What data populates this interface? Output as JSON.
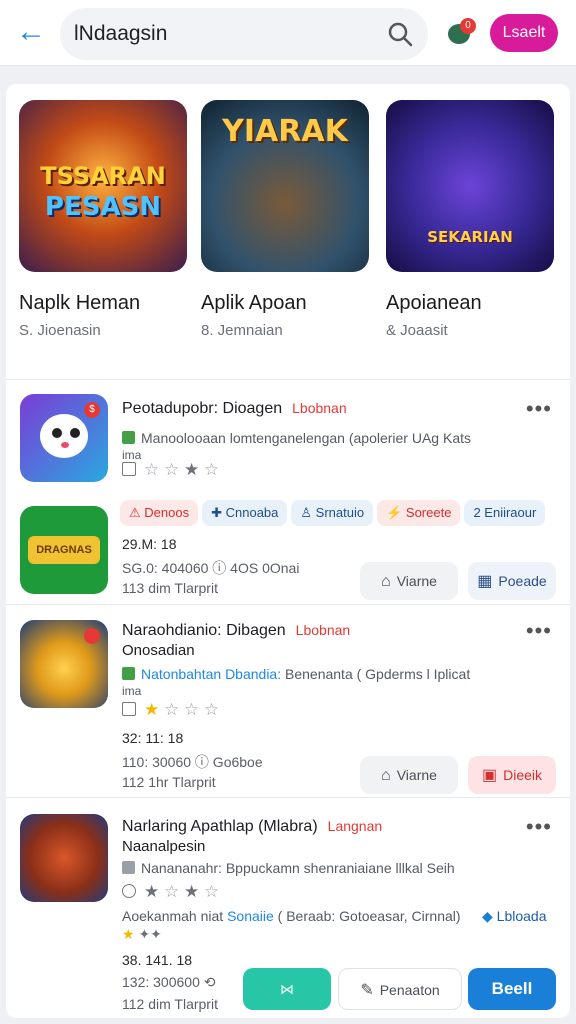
{
  "header": {
    "search_text": "lNdaagsin",
    "notification_count": "0",
    "action_label": "Lsaelt"
  },
  "featured": [
    {
      "art_line1": "TSSARAN",
      "art_line2": "PESASN",
      "name": "Naplk Heman",
      "sub": "S. Jioenasin"
    },
    {
      "art_line1": "YIARAK",
      "name": "Aplik Apoan",
      "sub": "8. Jemnaian"
    },
    {
      "art_line1": "SEKARIAN",
      "name": "Apoianean",
      "sub": "& Joaasit"
    }
  ],
  "items": [
    {
      "title": "Peotadupobr: Dioagen",
      "tag": "Lbobnan",
      "desc": "Manoolooaan lomtenganelengan (apolerier UAg Kats",
      "desc_extra": "ima",
      "chips": [
        "Denoos",
        "Cnnoaba",
        "Srnatuio",
        "Soreete",
        "Eniiraour"
      ],
      "stat1": "29.M: 18",
      "stat2": "SG.0:  404060   ⓘ  4OS 0Onai",
      "stat3": "113 dim  Tlarprit",
      "btn1": "Viarne",
      "btn2": "Poeade"
    },
    {
      "title": "Naraohdianio: Dibagen",
      "tag": "Lbobnan",
      "title2": "Onosadian",
      "desc_hl": "Natonbahtan Dbandia:",
      "desc": " Benenanta ( Gpderms l Iplicat",
      "desc_extra": "ima",
      "stat1": "32: 11: 18",
      "stat2": "110: 30060   ⓘ  Go6boe",
      "stat3": "112 1hr  Tlarprit",
      "btn1": "Viarne",
      "btn2": "Dieeik"
    },
    {
      "title": "Narlaring Apathlap (Mlabra)",
      "tag": "Langnan",
      "title2": "Naanalpesin",
      "desc": "Nanananahr: Bppuckamn shenraniaiane  lllkal Seih",
      "line4_pre": "Aoekanmah niat ",
      "line4_hl": "Sonaiie",
      "line4_post": " ( Beraab: Gotoeasar, Cirnnal)",
      "line4_right": "Lbloada",
      "stat1": "38. 141. 18",
      "stat2": "132: 300600",
      "stat3": "112 dim  Tlarprit",
      "btn2": "Penaaton",
      "btn3": "Beell"
    }
  ]
}
